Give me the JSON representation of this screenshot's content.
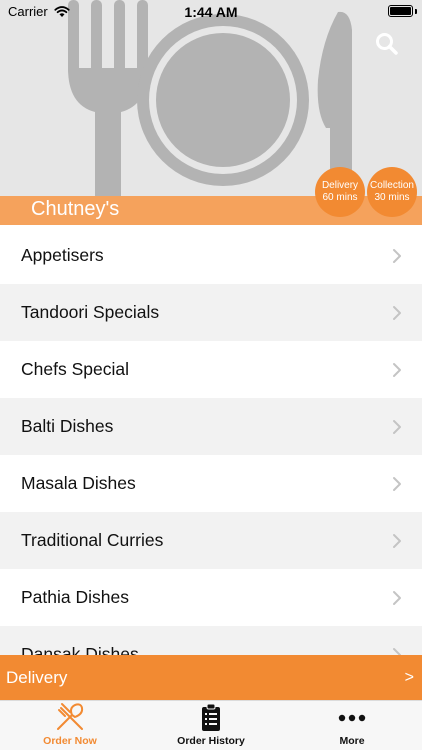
{
  "status_bar": {
    "carrier": "Carrier",
    "time": "1:44 AM"
  },
  "restaurant": {
    "name": "Chutney's"
  },
  "badges": {
    "delivery": {
      "label": "Delivery",
      "time": "60 mins"
    },
    "collection": {
      "label": "Collection",
      "time": "30 mins"
    }
  },
  "menu": {
    "items": [
      {
        "label": "Appetisers"
      },
      {
        "label": "Tandoori Specials"
      },
      {
        "label": "Chefs Special"
      },
      {
        "label": "Balti Dishes"
      },
      {
        "label": "Masala Dishes"
      },
      {
        "label": "Traditional Curries"
      },
      {
        "label": "Pathia Dishes"
      },
      {
        "label": "Dansak Dishes"
      }
    ]
  },
  "order_mode": {
    "label": "Delivery",
    "arrow": ">"
  },
  "tabs": [
    {
      "label": "Order Now",
      "icon": "fork-knife-icon",
      "active": true
    },
    {
      "label": "Order History",
      "icon": "clipboard-list-icon",
      "active": false
    },
    {
      "label": "More",
      "icon": "more-dots-icon",
      "active": false
    }
  ],
  "colors": {
    "accent": "#f28a32",
    "title_bar": "#f5a25c",
    "hero_bg": "#e6e6e6"
  }
}
